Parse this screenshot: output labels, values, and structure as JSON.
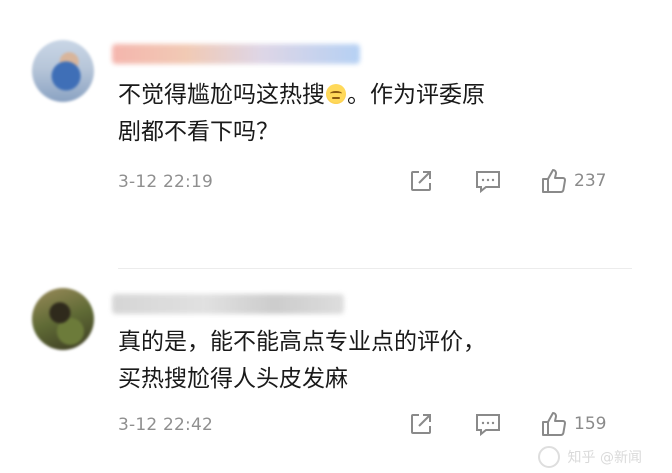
{
  "comments": [
    {
      "avatar": "user-avatar-photo",
      "username": "",
      "text_line1_a": "不觉得尴尬吗这热搜",
      "text_line1_b": "。作为评委原",
      "text_line2": "剧都不看下吗？",
      "timestamp": "3-12 22:19",
      "like_count": "237"
    },
    {
      "avatar": "user-avatar-photo",
      "username": "",
      "text_line1": "真的是，能不能高点专业点的评价，",
      "text_line2": "买热搜尬得人头皮发麻",
      "timestamp": "3-12 22:42",
      "like_count": "159"
    }
  ],
  "icons": {
    "share": "share-icon",
    "comment": "comment-icon",
    "like": "thumbs-up-icon",
    "emoji": "emoji-icon"
  },
  "watermark": "知乎 @新闻"
}
